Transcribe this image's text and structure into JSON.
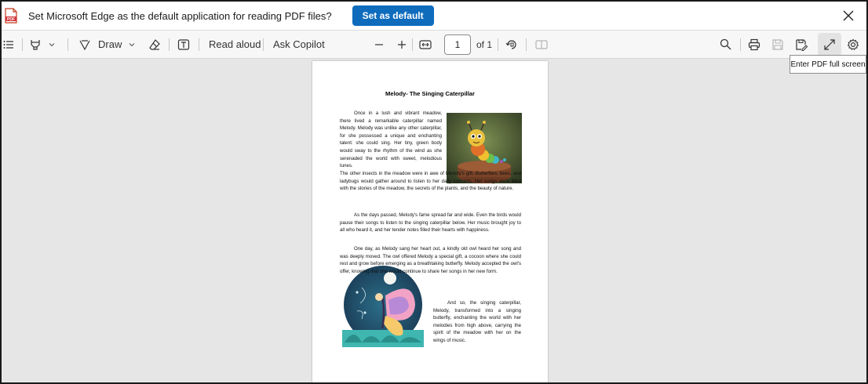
{
  "infobar": {
    "message": "Set Microsoft Edge as the default application for reading PDF files?",
    "button_label": "Set as default"
  },
  "toolbar": {
    "draw_label": "Draw",
    "read_aloud_label": "Read aloud",
    "ask_copilot_label": "Ask Copilot",
    "page_number": "1",
    "page_total": "of 1",
    "tooltip": "Enter PDF full screen"
  },
  "document": {
    "title": "Melody- The Singing Caterpillar",
    "paragraphs": [
      "Once in a lush and vibrant meadow, there lived a remarkable caterpillar named Melody. Melody was unlike any other caterpillar, for she possessed a unique and enchanting talent: she could sing. Her tiny, green body would sway to the rhythm of the wind as she serenaded the world with sweet, melodious tunes.",
      "The other insects in the meadow were in awe of Melody's gift. Butterflies, bees, and ladybugs would gather around to listen to her daily concerts. Her songs were filled with the stories of the meadow, the secrets of the plants, and the beauty of nature.",
      "As the days passed, Melody's fame spread far and wide. Even the birds would pause their songs to listen to the singing caterpillar below. Her music brought joy to all who heard it, and her tender notes filled their hearts with happiness.",
      "One day, as Melody sang her heart out, a kindly old owl heard her song and was deeply moved. The owl offered Melody a special gift, a cocoon where she could rest and grow before emerging as a breathtaking butterfly. Melody accepted the owl's offer, knowing that she would continue to share her songs in her new form.",
      "And so, the singing caterpillar, Melody, transformed into a singing butterfly, enchanting the world with her melodies from high above, carrying the spirit of the meadow with her on the wings of music."
    ]
  },
  "colors": {
    "accent": "#0f6cbd",
    "viewer_background": "#e6e6e6",
    "toolbar_background": "#f7f7f7"
  },
  "icons": {
    "infobar": [
      "pdf-file-icon",
      "close-icon"
    ],
    "toolbar_left": [
      "contents-icon",
      "highlight-icon",
      "chevron-down-icon",
      "draw-icon",
      "chevron-down-icon",
      "eraser-icon",
      "add-text-icon"
    ],
    "toolbar_mid": [
      "zoom-out-icon",
      "zoom-in-icon",
      "fit-page-icon",
      "rotate-icon",
      "page-view-icon"
    ],
    "toolbar_right": [
      "search-icon",
      "print-icon",
      "save-icon",
      "save-as-icon",
      "fullscreen-icon",
      "settings-icon"
    ]
  }
}
